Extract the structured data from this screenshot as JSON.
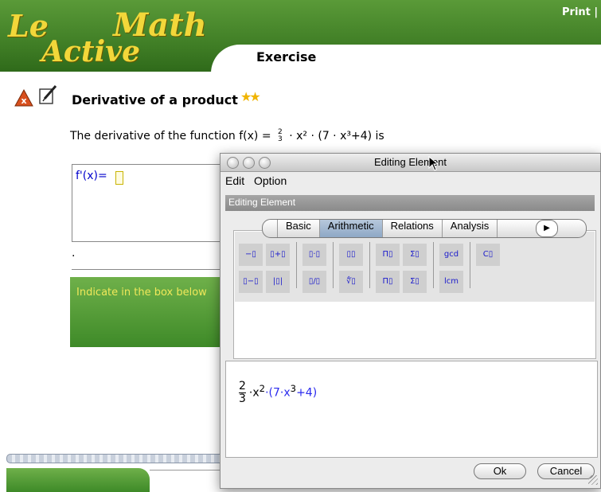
{
  "header": {
    "logo_le": "Le",
    "logo_math": "Math",
    "logo_active": "Active",
    "print_label": "Print |",
    "section_title": "Exercise",
    "brand_green": "#3f7d25",
    "logo_yellow": "#f2d73a"
  },
  "exercise": {
    "title": "Derivative of a product",
    "stars": "★★",
    "question_prefix": "The derivative of the function f(x) =",
    "q_num": "2",
    "q_den": "3",
    "question_suffix": "· x² · (7 · x³+4) is",
    "answer_label": "f'(x)=",
    "dot": ".",
    "hint_text": "Indicate in the box below"
  },
  "icons": {
    "delete": "delete-icon",
    "edit": "edit-icon",
    "star": "star-icon"
  },
  "dialog": {
    "title": "Editing Element",
    "menu_edit": "Edit",
    "menu_option": "Option",
    "section_label": "Editing Element",
    "tabs": [
      {
        "label": "Basic",
        "selected": false
      },
      {
        "label": "Arithmetic",
        "selected": true
      },
      {
        "label": "Relations",
        "selected": false
      },
      {
        "label": "Analysis",
        "selected": false
      }
    ],
    "palette": {
      "negate": "−▯",
      "plus": "▯+▯",
      "times": "▯·▯",
      "power": "▯▯",
      "product": "Π▯",
      "sum": "Σ▯",
      "gcd": "gcd",
      "binomial": "C▯",
      "minus": "▯−▯",
      "abs": "|▯|",
      "fraction": "▯/▯",
      "root": "∜▯",
      "product2": "Π▯",
      "sum2": "Σ▯",
      "lcm": "lcm"
    },
    "formula": {
      "num": "2",
      "den": "3",
      "x": "·x",
      "exp2": "2",
      "dot_paren": "·(7·x",
      "exp3": "3",
      "plus4": "+4)"
    },
    "ok_label": "Ok",
    "cancel_label": "Cancel"
  }
}
